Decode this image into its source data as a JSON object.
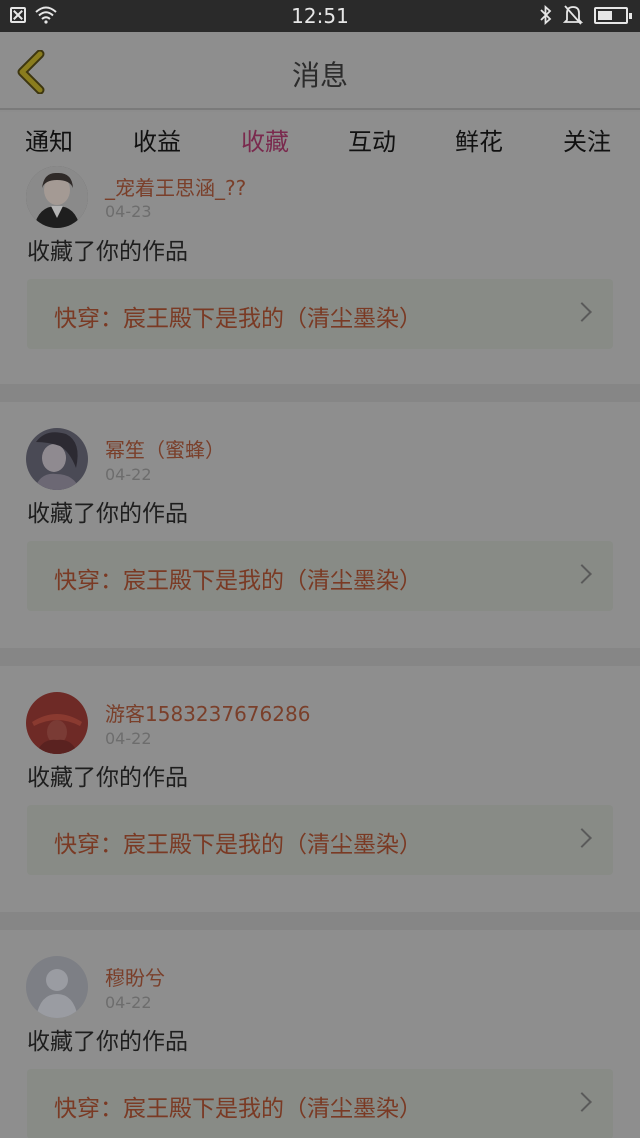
{
  "status_bar": {
    "time": "12:51"
  },
  "header": {
    "title": "消息"
  },
  "tabs": [
    {
      "label": "通知"
    },
    {
      "label": "收益"
    },
    {
      "label": "收藏"
    },
    {
      "label": "互动"
    },
    {
      "label": "鲜花"
    },
    {
      "label": "关注"
    }
  ],
  "active_tab": "收藏",
  "messages": [
    {
      "user": "_宠着王思涵_??",
      "date": "04-23",
      "action": "收藏了你的作品",
      "work": "快穿：宸王殿下是我的（清尘墨染）"
    },
    {
      "user": "幂笙（蜜蜂）",
      "date": "04-22",
      "action": "收藏了你的作品",
      "work": "快穿：宸王殿下是我的（清尘墨染）"
    },
    {
      "user": "游客1583237676286",
      "date": "04-22",
      "action": "收藏了你的作品",
      "work": "快穿：宸王殿下是我的（清尘墨染）"
    },
    {
      "user": "穆盼兮",
      "date": "04-22",
      "action": "收藏了你的作品",
      "work": "快穿：宸王殿下是我的（清尘墨染）"
    }
  ],
  "colors": {
    "accent": "#7a2a4e",
    "username": "#7a3f2a",
    "work_title": "#7a3a24",
    "overlay_dim": "#8c8c8c"
  }
}
